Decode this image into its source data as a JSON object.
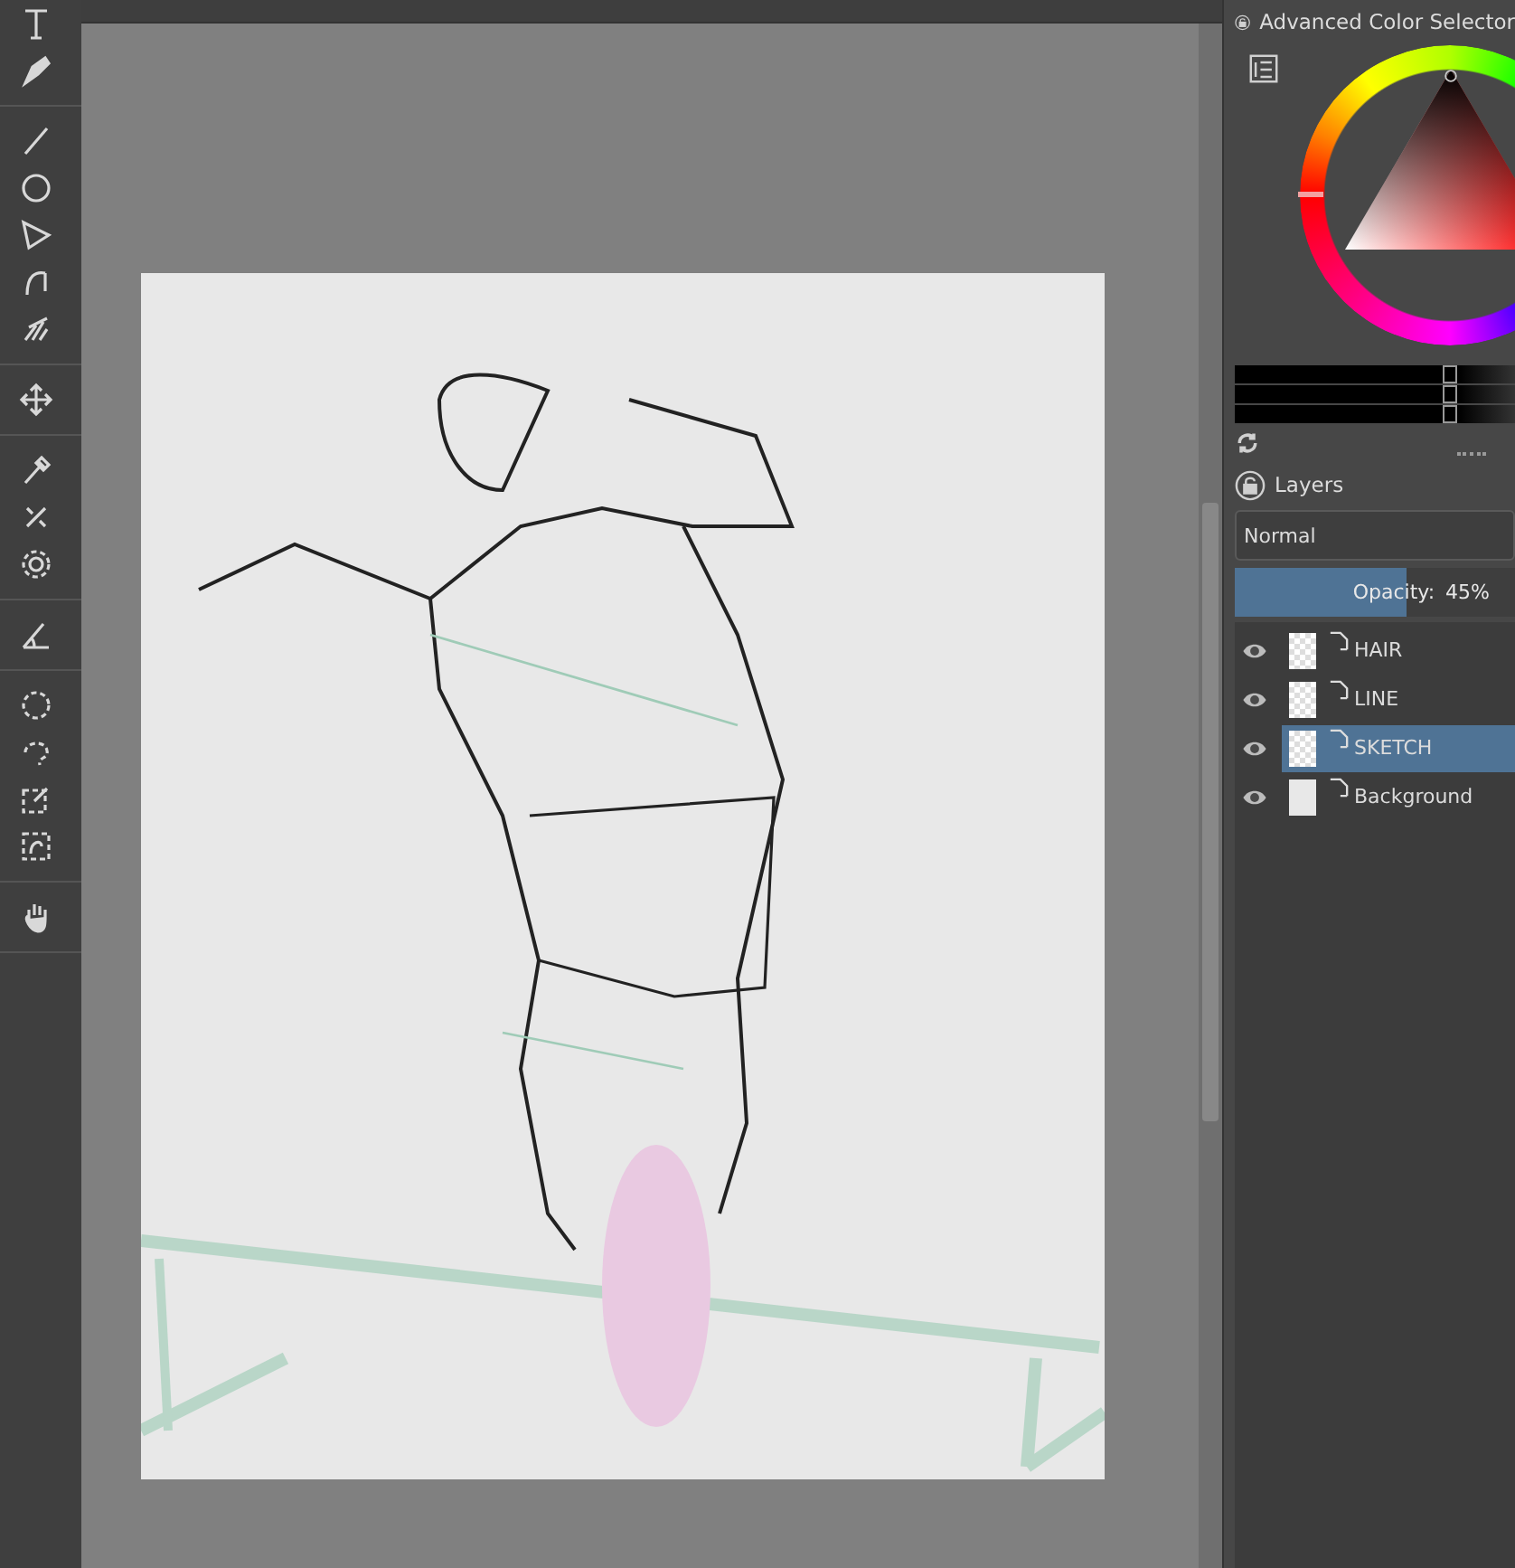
{
  "color_selector": {
    "title": "Advanced Color Selector",
    "sliders": [
      {
        "level": 0.77
      },
      {
        "level": 0.77
      },
      {
        "level": 0.77
      }
    ]
  },
  "layers_docker": {
    "title": "Layers",
    "blend_mode": "Normal",
    "opacity": {
      "label": "Opacity:",
      "value": "45%",
      "level": 0.61
    },
    "layers": [
      {
        "name": "HAIR",
        "visible": true,
        "selected": false
      },
      {
        "name": "LINE",
        "visible": true,
        "selected": false
      },
      {
        "name": "SKETCH",
        "visible": true,
        "selected": true
      },
      {
        "name": "Background",
        "visible": true,
        "selected": false
      }
    ]
  }
}
